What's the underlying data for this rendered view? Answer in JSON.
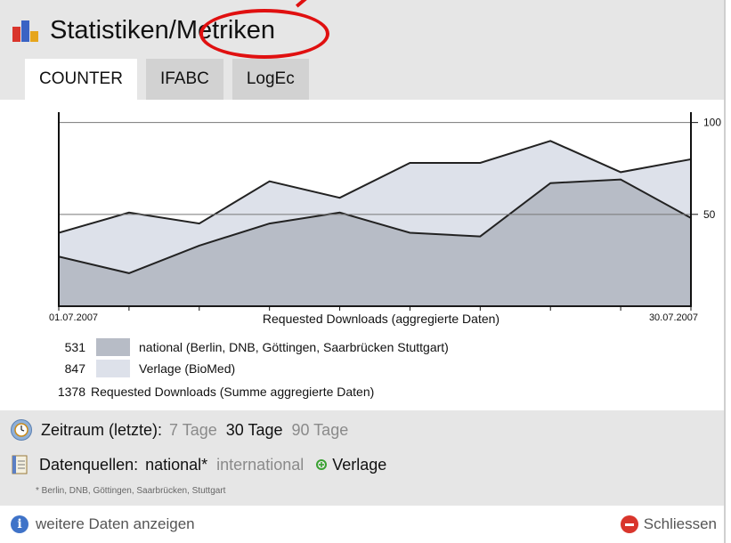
{
  "header": {
    "title": "Statistiken/Metriken",
    "icon": "bar-chart-icon"
  },
  "tabs": [
    {
      "label": "COUNTER",
      "active": true
    },
    {
      "label": "IFABC",
      "active": false
    },
    {
      "label": "LogEc",
      "active": false
    }
  ],
  "chart_data": {
    "type": "area",
    "title": "",
    "xlabel": "Requested Downloads (aggregierte Daten)",
    "x_tick_labels": [
      "01.07.2007",
      "30.07.2007"
    ],
    "y_tick_labels": [
      "100",
      "50"
    ],
    "ylim": [
      0,
      110
    ],
    "x": [
      0,
      1,
      2,
      3,
      4,
      5,
      6,
      7,
      8,
      9
    ],
    "series": [
      {
        "name": "Verlage (BioMed)",
        "color": "#dde1ea",
        "values": [
          40,
          51,
          45,
          68,
          59,
          78,
          78,
          90,
          73,
          80
        ]
      },
      {
        "name": "national (Berlin, DNB, Göttingen, Saarbrücken Stuttgart)",
        "color": "#b7bcc6",
        "values": [
          27,
          18,
          33,
          45,
          51,
          40,
          38,
          67,
          69,
          48
        ]
      }
    ],
    "reference_lines": [
      50,
      100
    ],
    "grid": false
  },
  "legend": [
    {
      "count": "531",
      "color": "#b7bcc6",
      "label": "national (Berlin, DNB, Göttingen, Saarbrücken Stuttgart)"
    },
    {
      "count": "847",
      "color": "#dde1ea",
      "label": "Verlage (BioMed)"
    },
    {
      "count": "1378",
      "color": "",
      "label": "Requested Downloads (Summe aggregierte Daten)"
    }
  ],
  "period": {
    "label": "Zeitraum (letzte):",
    "options": [
      "7 Tage",
      "30 Tage",
      "90 Tage"
    ],
    "selected": "30 Tage",
    "icon": "clock-icon"
  },
  "sources": {
    "label": "Datenquellen:",
    "national": "national*",
    "international": "international",
    "verlage": "Verlage",
    "footnote": "* Berlin, DNB, Göttingen, Saarbrücken, Stuttgart",
    "icon": "notepad-icon",
    "add_icon": "plus-circle-icon"
  },
  "footer": {
    "more_label": "weitere Daten anzeigen",
    "close_label": "Schliessen",
    "info_icon": "info-icon",
    "close_icon": "minus-circle-icon"
  }
}
